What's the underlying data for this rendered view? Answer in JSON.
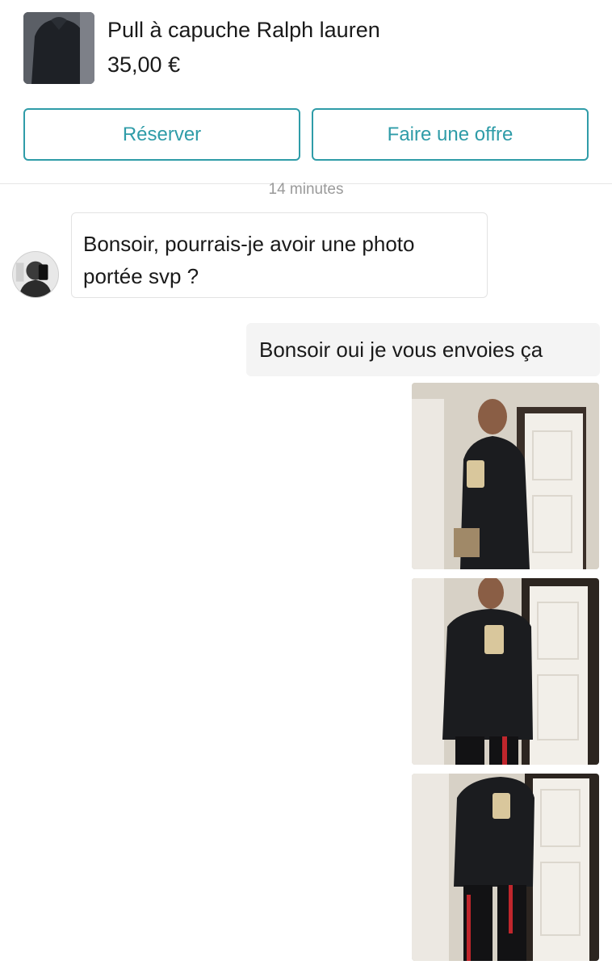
{
  "product": {
    "title": "Pull à capuche Ralph lauren",
    "price": "35,00 €",
    "thumbnail_icon": "hoodie-photo"
  },
  "actions": {
    "reserve_label": "Réserver",
    "offer_label": "Faire une offre"
  },
  "chat": {
    "timestamp": "14 minutes",
    "incoming_message": "Bonsoir, pourrais-je avoir une photo portée svp ?",
    "outgoing_message": "Bonsoir oui je vous envoies ça",
    "photos": [
      "mirror-selfie-photo-1",
      "mirror-selfie-photo-2",
      "mirror-selfie-photo-3"
    ]
  },
  "colors": {
    "accent": "#2f9ca8",
    "bubble_out_bg": "#f4f4f4",
    "muted_text": "#9a9a9a"
  }
}
